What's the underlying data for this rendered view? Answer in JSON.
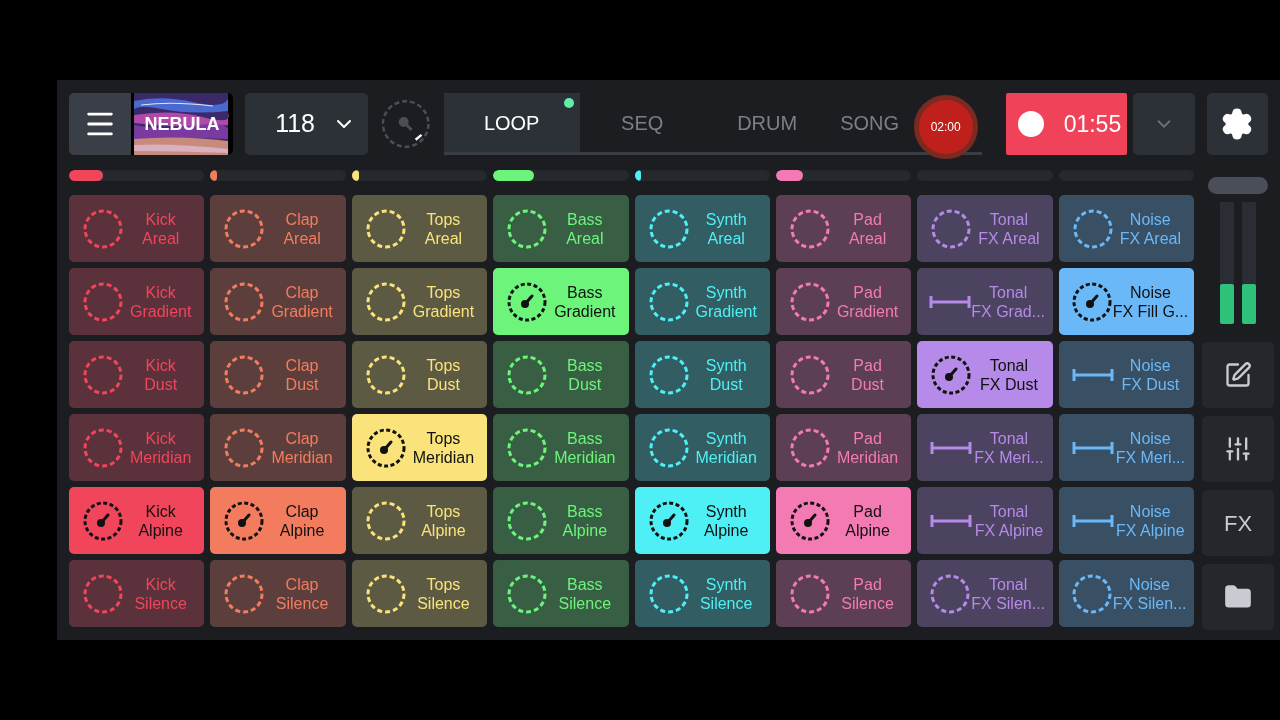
{
  "header": {
    "title": "NEBULA",
    "bpm": "118",
    "song_marker": "02:00",
    "record_time": "01:55"
  },
  "tabs": [
    {
      "label": "LOOP",
      "selected": true,
      "playing": true
    },
    {
      "label": "SEQ",
      "selected": false,
      "playing": false
    },
    {
      "label": "DRUM",
      "selected": false,
      "playing": false
    },
    {
      "label": "SONG",
      "selected": false,
      "playing": false
    }
  ],
  "columns": [
    {
      "color": "#f0455a",
      "level": 0.25,
      "pads": [
        {
          "kind": "loop",
          "line1": "Kick",
          "line2": "Areal",
          "playing": false
        },
        {
          "kind": "loop",
          "line1": "Kick",
          "line2": "Gradient",
          "playing": false
        },
        {
          "kind": "loop",
          "line1": "Kick",
          "line2": "Dust",
          "playing": false
        },
        {
          "kind": "loop",
          "line1": "Kick",
          "line2": "Meridian",
          "playing": false
        },
        {
          "kind": "loop",
          "line1": "Kick",
          "line2": "Alpine",
          "playing": true
        },
        {
          "kind": "loop",
          "line1": "Kick",
          "line2": "Silence",
          "playing": false
        }
      ]
    },
    {
      "color": "#f47c5e",
      "level": 0.04,
      "pads": [
        {
          "kind": "loop",
          "line1": "Clap",
          "line2": "Areal",
          "playing": false
        },
        {
          "kind": "loop",
          "line1": "Clap",
          "line2": "Gradient",
          "playing": false
        },
        {
          "kind": "loop",
          "line1": "Clap",
          "line2": "Dust",
          "playing": false
        },
        {
          "kind": "loop",
          "line1": "Clap",
          "line2": "Meridian",
          "playing": false
        },
        {
          "kind": "loop",
          "line1": "Clap",
          "line2": "Alpine",
          "playing": true
        },
        {
          "kind": "loop",
          "line1": "Clap",
          "line2": "Silence",
          "playing": false
        }
      ]
    },
    {
      "color": "#f9e37a",
      "level": 0.04,
      "pads": [
        {
          "kind": "loop",
          "line1": "Tops",
          "line2": "Areal",
          "playing": false
        },
        {
          "kind": "loop",
          "line1": "Tops",
          "line2": "Gradient",
          "playing": false
        },
        {
          "kind": "loop",
          "line1": "Tops",
          "line2": "Dust",
          "playing": false
        },
        {
          "kind": "loop",
          "line1": "Tops",
          "line2": "Meridian",
          "playing": true
        },
        {
          "kind": "loop",
          "line1": "Tops",
          "line2": "Alpine",
          "playing": false
        },
        {
          "kind": "loop",
          "line1": "Tops",
          "line2": "Silence",
          "playing": false
        }
      ]
    },
    {
      "color": "#6cf57a",
      "level": 0.3,
      "pads": [
        {
          "kind": "loop",
          "line1": "Bass",
          "line2": "Areal",
          "playing": false
        },
        {
          "kind": "loop",
          "line1": "Bass",
          "line2": "Gradient",
          "playing": true
        },
        {
          "kind": "loop",
          "line1": "Bass",
          "line2": "Dust",
          "playing": false
        },
        {
          "kind": "loop",
          "line1": "Bass",
          "line2": "Meridian",
          "playing": false
        },
        {
          "kind": "loop",
          "line1": "Bass",
          "line2": "Alpine",
          "playing": false
        },
        {
          "kind": "loop",
          "line1": "Bass",
          "line2": "Silence",
          "playing": false
        }
      ]
    },
    {
      "color": "#4ff0f5",
      "level": 0.04,
      "pads": [
        {
          "kind": "loop",
          "line1": "Synth",
          "line2": "Areal",
          "playing": false
        },
        {
          "kind": "loop",
          "line1": "Synth",
          "line2": "Gradient",
          "playing": false
        },
        {
          "kind": "loop",
          "line1": "Synth",
          "line2": "Dust",
          "playing": false
        },
        {
          "kind": "loop",
          "line1": "Synth",
          "line2": "Meridian",
          "playing": false
        },
        {
          "kind": "loop",
          "line1": "Synth",
          "line2": "Alpine",
          "playing": true
        },
        {
          "kind": "loop",
          "line1": "Synth",
          "line2": "Silence",
          "playing": false
        }
      ]
    },
    {
      "color": "#f47ab4",
      "level": 0.2,
      "pads": [
        {
          "kind": "loop",
          "line1": "Pad",
          "line2": "Areal",
          "playing": false
        },
        {
          "kind": "loop",
          "line1": "Pad",
          "line2": "Gradient",
          "playing": false
        },
        {
          "kind": "loop",
          "line1": "Pad",
          "line2": "Dust",
          "playing": false
        },
        {
          "kind": "loop",
          "line1": "Pad",
          "line2": "Meridian",
          "playing": false
        },
        {
          "kind": "loop",
          "line1": "Pad",
          "line2": "Alpine",
          "playing": true
        },
        {
          "kind": "loop",
          "line1": "Pad",
          "line2": "Silence",
          "playing": false
        }
      ]
    },
    {
      "color": "#b58ae8",
      "pads": [
        {
          "kind": "loop",
          "line1": "Tonal",
          "line2": "FX Areal",
          "playing": false
        },
        {
          "kind": "oneshot",
          "line1": "Tonal",
          "line2": "FX Grad...",
          "playing": false
        },
        {
          "kind": "loop",
          "line1": "Tonal",
          "line2": "FX Dust",
          "playing": true
        },
        {
          "kind": "oneshot",
          "line1": "Tonal",
          "line2": "FX Meri...",
          "playing": false
        },
        {
          "kind": "oneshot",
          "line1": "Tonal",
          "line2": "FX Alpine",
          "playing": false
        },
        {
          "kind": "loop",
          "line1": "Tonal",
          "line2": "FX Silen...",
          "playing": false
        }
      ]
    },
    {
      "color": "#6bb8f8",
      "pads": [
        {
          "kind": "loop",
          "line1": "Noise",
          "line2": "FX Areal",
          "playing": false
        },
        {
          "kind": "loop",
          "line1": "Noise",
          "line2": "FX Fill G...",
          "playing": true
        },
        {
          "kind": "oneshot",
          "line1": "Noise",
          "line2": "FX Dust",
          "playing": false
        },
        {
          "kind": "oneshot",
          "line1": "Noise",
          "line2": "FX Meri...",
          "playing": false
        },
        {
          "kind": "oneshot",
          "line1": "Noise",
          "line2": "FX Alpine",
          "playing": false
        },
        {
          "kind": "loop",
          "line1": "Noise",
          "line2": "FX Silen...",
          "playing": false
        }
      ]
    }
  ],
  "meters": [
    {
      "level": 0.33
    },
    {
      "level": 0.33
    }
  ],
  "side_buttons": [
    {
      "kind": "edit"
    },
    {
      "kind": "mixer"
    },
    {
      "kind": "text",
      "label": "FX"
    },
    {
      "kind": "folder"
    }
  ]
}
